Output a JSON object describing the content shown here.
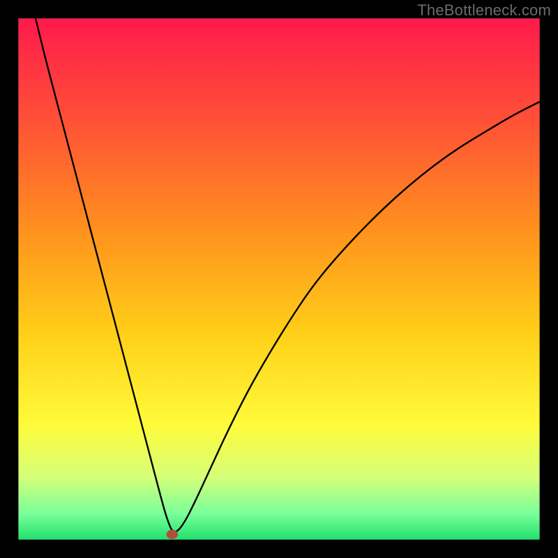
{
  "watermark": "TheBottleneck.com",
  "chart_data": {
    "type": "line",
    "title": "",
    "xlabel": "",
    "ylabel": "",
    "xlim": [
      0,
      100
    ],
    "ylim": [
      0,
      100
    ],
    "grid": false,
    "legend": false,
    "background": {
      "type": "vertical_gradient",
      "stops": [
        {
          "offset": 0.0,
          "color": "#ff1a4b"
        },
        {
          "offset": 0.2,
          "color": "#ff5236"
        },
        {
          "offset": 0.4,
          "color": "#ff8f1e"
        },
        {
          "offset": 0.6,
          "color": "#ffce18"
        },
        {
          "offset": 0.78,
          "color": "#fffb3a"
        },
        {
          "offset": 0.88,
          "color": "#d5ff78"
        },
        {
          "offset": 0.95,
          "color": "#7aff9a"
        },
        {
          "offset": 1.0,
          "color": "#22e06e"
        }
      ]
    },
    "frame": {
      "color": "#000000",
      "width_y_pct": 3.3,
      "width_x_pct": 3.3
    },
    "series": [
      {
        "name": "bottleneck-curve",
        "type": "line",
        "color": "#000000",
        "x": [
          3.3,
          5,
          7.5,
          10,
          12.5,
          15,
          17.5,
          20,
          22.5,
          25,
          27.5,
          28.5,
          29.5,
          30.5,
          32,
          34,
          37,
          40,
          44,
          48,
          52,
          56,
          60,
          65,
          70,
          75,
          80,
          85,
          90,
          95,
          100
        ],
        "values": [
          100,
          93,
          83.5,
          74,
          64.5,
          55,
          45.5,
          36,
          26.5,
          17,
          7.5,
          4,
          1.5,
          1.5,
          3.5,
          7.5,
          14,
          20.5,
          28.5,
          35.5,
          42,
          48,
          53,
          58.5,
          63.5,
          68,
          72,
          75.5,
          78.5,
          81.5,
          84
        ]
      }
    ],
    "markers": [
      {
        "name": "min-marker",
        "x": 29.5,
        "y": 1.0,
        "rx": 1.1,
        "ry": 0.9,
        "color": "#b24d3c"
      }
    ]
  }
}
